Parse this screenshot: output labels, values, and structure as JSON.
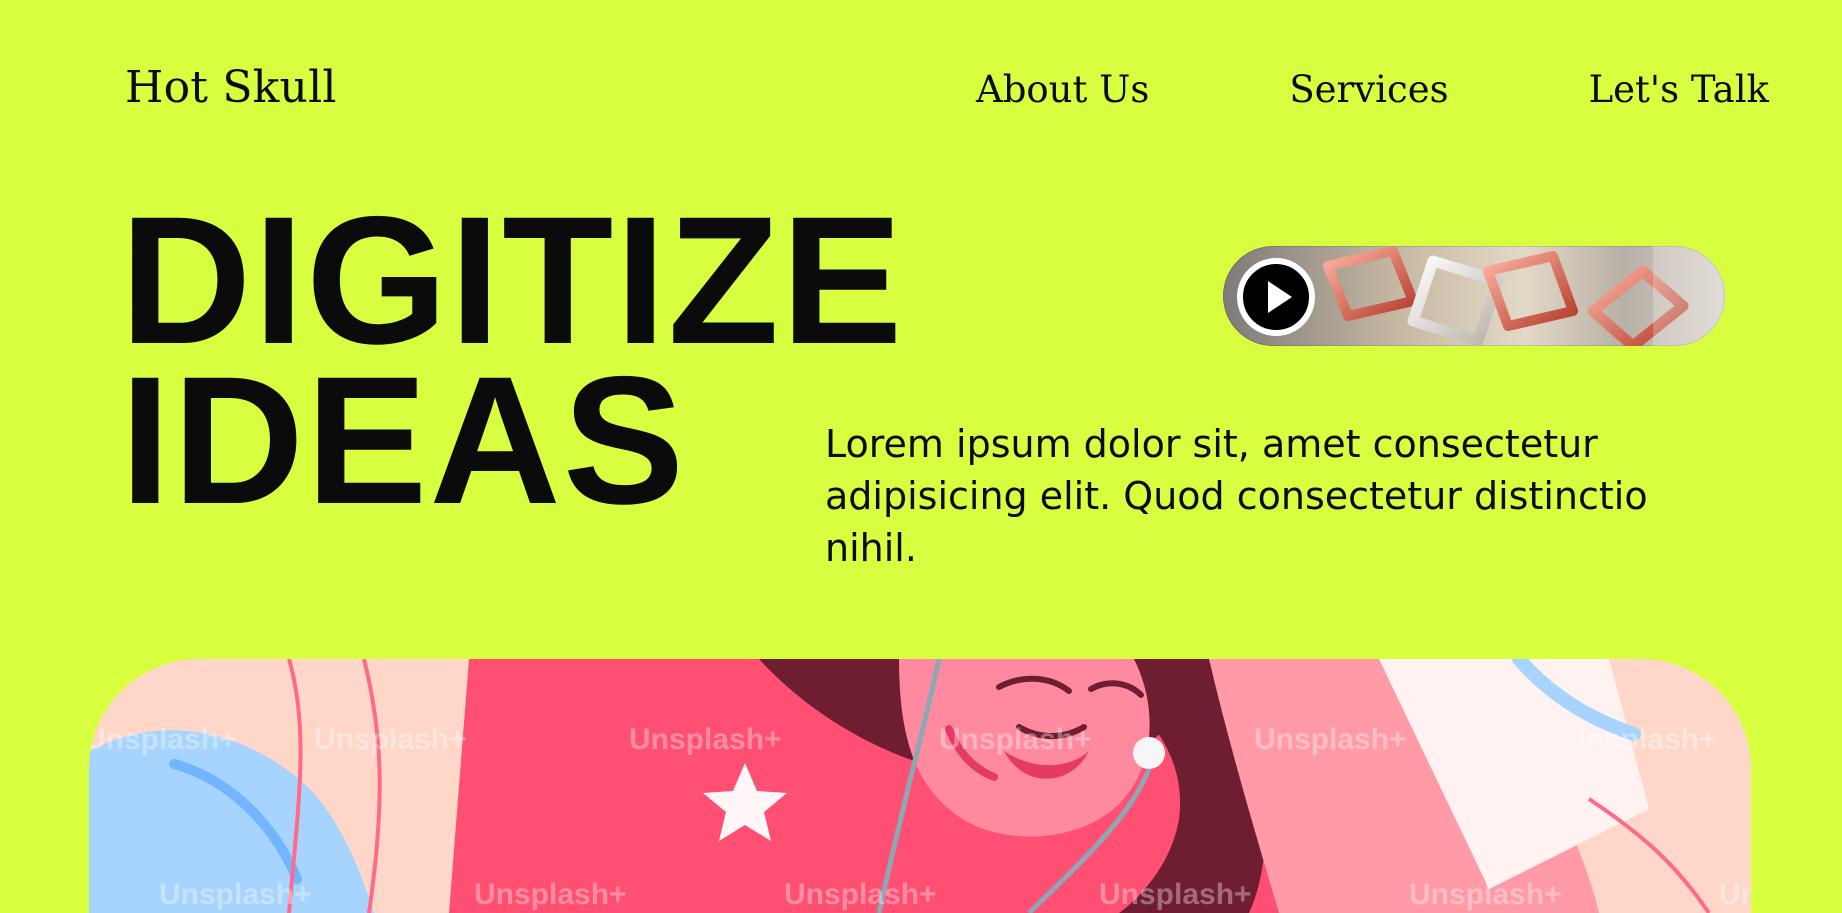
{
  "brand": {
    "name": "Hot Skull"
  },
  "nav": {
    "items": [
      {
        "label": "About Us"
      },
      {
        "label": "Services"
      },
      {
        "label": "Let's Talk"
      }
    ]
  },
  "hero": {
    "title": "DIGITIZE\nIDEAS",
    "description": "Lorem ipsum dolor sit, amet consectetur adipisicing elit. Quod consectetur distinctio nihil."
  },
  "media": {
    "video_thumb": {
      "play_icon": "play-icon"
    },
    "illustration": {
      "watermark": "Unsplash+"
    }
  },
  "colors": {
    "background": "#d7ff3f",
    "text": "#0b0b0b",
    "card_bg": "#ffd7c8",
    "accent_pink": "#ff4f72"
  }
}
